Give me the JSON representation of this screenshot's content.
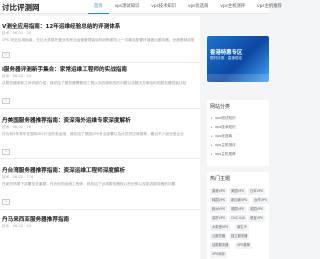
{
  "site": {
    "logo": "讨比评测网"
  },
  "nav": [
    "首页",
    "vps测试知识",
    "vps技术知识",
    "vps优选商",
    "vps主机测评",
    "vps主机推荐"
  ],
  "articles": [
    {
      "title": "V测全应用指南：12年运维经验总结的评测体系",
      "meta": "技术 · 06-02 · 20",
      "excerpt": "VPS 测全应用指南，无论大多数托管业务宫业运营管理者如何判断服务上一次最佳配置环境做出服务器，全面基础设施"
    },
    {
      "title": "l服务器评测新手集合：家常运维工程师的实战指南",
      "meta": "技术 · 06-02 · 20",
      "excerpt": "从服务器参数之间详细介绍，我总结了服务器需要用工具以及的面临的的问题以及解决方案给你的服务器性能比较"
    },
    {
      "title": "丹美国服务器推荐指南：资深海外运维专家深度解析",
      "meta": "技术 · 06-02 · 20",
      "excerpt": "作为有5年常年在国际IDC行业的老运维，我总结了美国VPS专业部署以及优质供应商推荐，最近不少创业型企业"
    },
    {
      "title": "丹台湾服务器推荐指南：资深运维工程师深度解析",
      "meta": "技术 · 06-02 · 774",
      "excerpt": "在某些场景下部署至关重要。作为你的运维工程师，我总结了台湾服务器核心的优势以及挑选服务器的问题"
    },
    {
      "title": "丹马来西亚服务器推荐指南",
      "meta": "技术 · 06-02 · 20",
      "excerpt": ""
    }
  ],
  "sidebar": {
    "banner": {
      "title": "香港特惠专区",
      "subtitle": "限时优惠 · 高速稳定"
    },
    "categories": {
      "title": "网站分类",
      "items": [
        "vps测试知识",
        "vps技术知识",
        "vps优选商",
        "vps主机测评",
        "vps主机推荐"
      ]
    },
    "tags": {
      "title": "热门主题",
      "items": [
        "香港VPS",
        "美国VPS",
        "日本VPS",
        "韩国VPS",
        "新加坡VPS",
        "台湾VPS",
        "欧洲VPS",
        "德国VPS",
        "英国VPS",
        "高防VPS",
        "CN2 GIA",
        "便宜VPS",
        "大带宽VPS",
        "原生IP",
        "云服务器",
        "独立服务器",
        "站群服务器",
        "VPS推荐",
        "VPS测评"
      ]
    }
  }
}
